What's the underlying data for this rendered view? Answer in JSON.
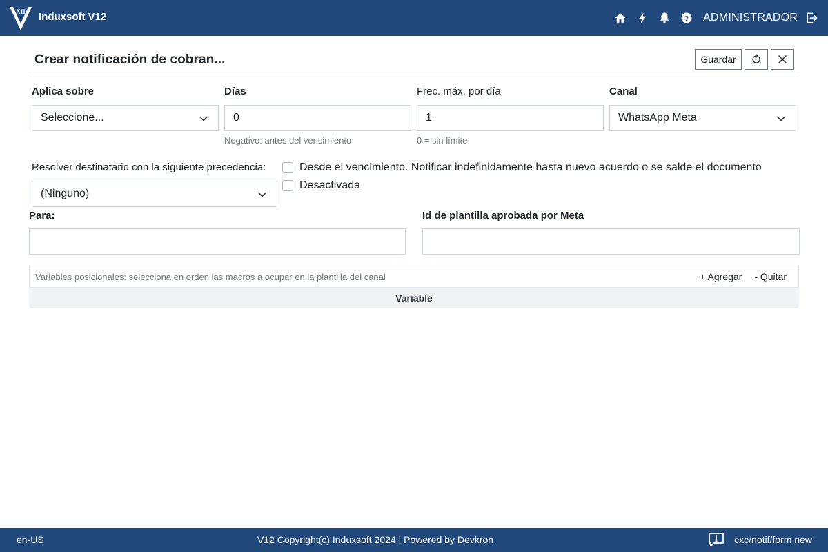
{
  "app": {
    "title": "Induxsoft V12",
    "user": "ADMINISTRADOR",
    "brand_color": "#21497c"
  },
  "header_icons": [
    "home-icon",
    "bolt-icon",
    "bell-icon",
    "help-icon",
    "logout-icon"
  ],
  "page": {
    "title": "Crear notificación de cobran...",
    "save_label": "Guardar"
  },
  "form": {
    "aplica_sobre": {
      "label": "Aplica sobre",
      "value": "Seleccione..."
    },
    "dias": {
      "label": "Días",
      "value": "0",
      "hint": "Negativo: antes del vencimiento"
    },
    "frecuencia": {
      "label": "Frec. máx. por día",
      "value": "1",
      "hint": "0 = sin límite"
    },
    "canal": {
      "label": "Canal",
      "value": "WhatsApp Meta"
    },
    "precedencia": {
      "label": "Resolver destinatario con la siguiente precedencia:",
      "value": "(Ninguno)"
    },
    "checkbox_vencimiento": {
      "label": "Desde el vencimiento. Notificar indefinidamente hasta nuevo acuerdo o se salde el documento",
      "checked": false
    },
    "checkbox_desactivada": {
      "label": "Desactivada",
      "checked": false
    },
    "para": {
      "label": "Para:",
      "value": ""
    },
    "plantilla": {
      "label": "Id de plantilla aprobada por Meta",
      "value": ""
    }
  },
  "variables": {
    "description": "Variables posicionales: selecciona en orden las macros a ocupar en la plantilla del canal",
    "add_label": "+ Agregar",
    "remove_label": "- Quitar",
    "columns": [
      "Variable"
    ],
    "rows": []
  },
  "footer": {
    "locale": "en-US",
    "copyright": "V12 Copyright(c) Induxsoft 2024 | Powered by Devkron",
    "route": "cxc/notif/form new"
  }
}
